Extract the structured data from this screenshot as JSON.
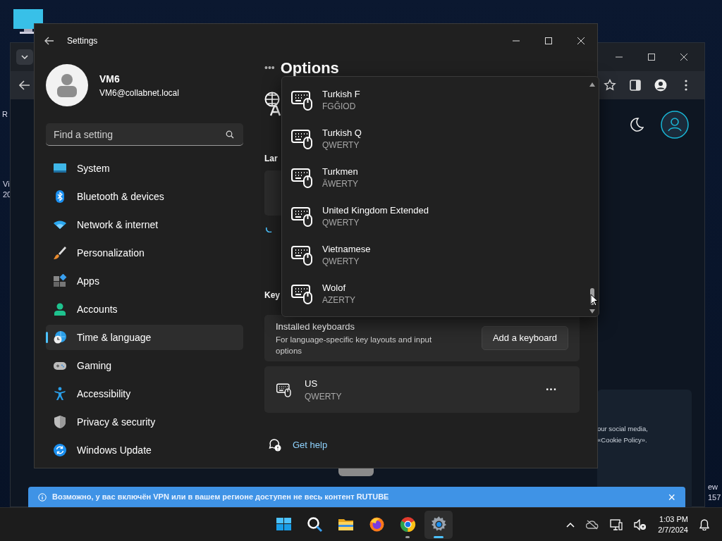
{
  "desktop": {
    "labels": [
      "R",
      "Vi",
      "20",
      "ew",
      "157"
    ]
  },
  "browser": {
    "page_text": [
      "our social media,",
      "«Cookie Policy»."
    ],
    "banner": {
      "text": "Возможно, у вас включён VPN или в вашем регионе доступен не весь контент RUTUBE",
      "close": "×"
    }
  },
  "settings": {
    "title": "Settings",
    "user": {
      "name": "VM6",
      "email": "VM6@collabnet.local"
    },
    "search": {
      "placeholder": "Find a setting"
    },
    "nav": [
      {
        "label": "System",
        "selected": false
      },
      {
        "label": "Bluetooth & devices",
        "selected": false
      },
      {
        "label": "Network & internet",
        "selected": false
      },
      {
        "label": "Personalization",
        "selected": false
      },
      {
        "label": "Apps",
        "selected": false
      },
      {
        "label": "Accounts",
        "selected": false
      },
      {
        "label": "Time & language",
        "selected": true
      },
      {
        "label": "Gaming",
        "selected": false
      },
      {
        "label": "Accessibility",
        "selected": false
      },
      {
        "label": "Privacy & security",
        "selected": false
      },
      {
        "label": "Windows Update",
        "selected": false
      }
    ],
    "page": {
      "breadcrumb": "•••",
      "heading": "Options",
      "section_1": "Lar",
      "section_2": "Key",
      "installed": {
        "title": "Installed keyboards",
        "description": "For language-specific key layouts and input options",
        "button": "Add a keyboard"
      },
      "keyboards": [
        {
          "name": "US",
          "layout": "QWERTY",
          "more": "···"
        }
      ],
      "help": "Get help"
    },
    "dropdown": {
      "items": [
        {
          "name": "Turkish F",
          "layout": "FGĞIOD"
        },
        {
          "name": "Turkish Q",
          "layout": "QWERTY"
        },
        {
          "name": "Turkmen",
          "layout": "ÄWERTY"
        },
        {
          "name": "United Kingdom Extended",
          "layout": "QWERTY"
        },
        {
          "name": "Vietnamese",
          "layout": "QWERTY"
        },
        {
          "name": "Wolof",
          "layout": "AZERTY"
        }
      ]
    }
  },
  "taskbar": {
    "apps": [
      {
        "kind": "start",
        "running": false,
        "selected": false
      },
      {
        "kind": "search",
        "running": false,
        "selected": false
      },
      {
        "kind": "explorer",
        "running": false,
        "selected": false
      },
      {
        "kind": "firefox",
        "running": false,
        "selected": false
      },
      {
        "kind": "chrome",
        "running": true,
        "selected": false
      },
      {
        "kind": "settings",
        "running": true,
        "selected": true
      }
    ],
    "clock": {
      "time": "1:03 PM",
      "date": "2/7/2024"
    }
  }
}
